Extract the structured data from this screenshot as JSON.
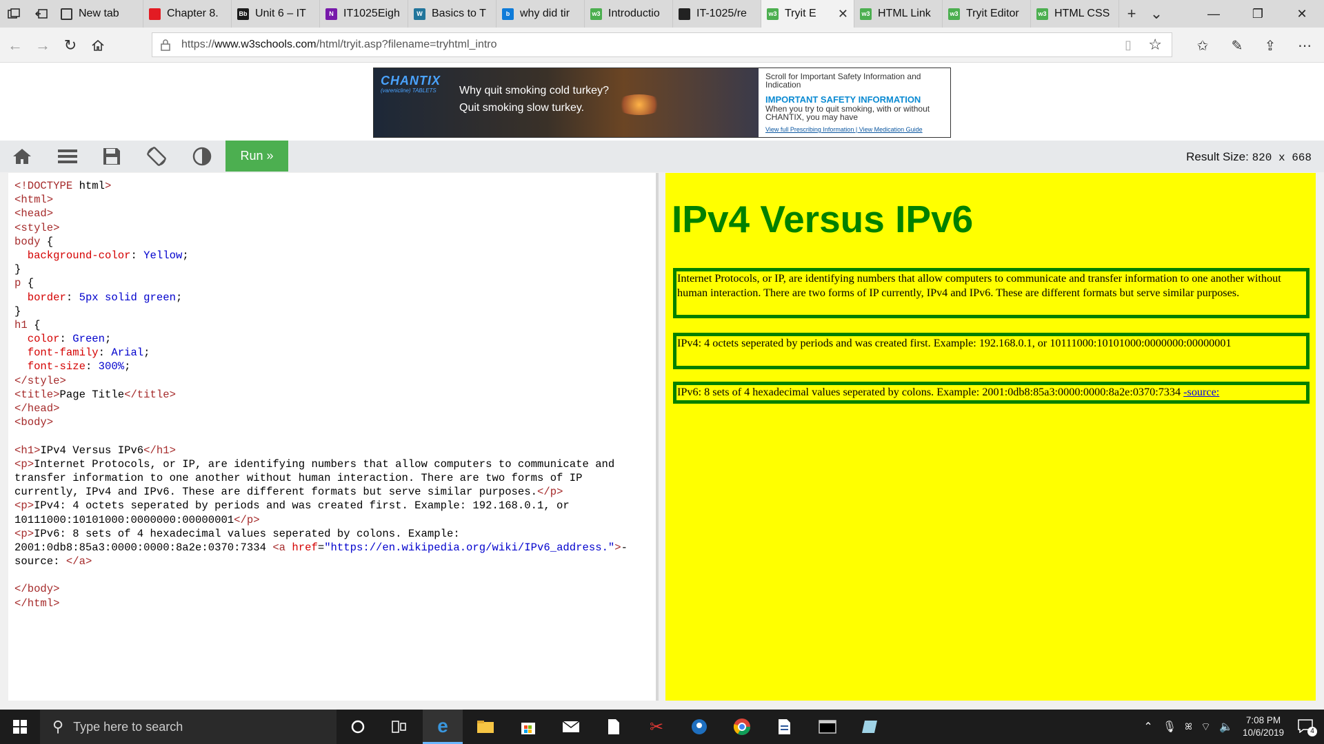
{
  "browser": {
    "tabs": [
      {
        "label": "New tab",
        "icon": "newtab-icon"
      },
      {
        "label": "Chapter 8.",
        "icon": "page-icon"
      },
      {
        "label": "Unit 6 – IT",
        "icon": "bb-icon",
        "badge": "Bb"
      },
      {
        "label": "IT1025Eigh",
        "icon": "onenote-icon",
        "badge": "N"
      },
      {
        "label": "Basics to T",
        "icon": "wordpress-icon",
        "badge": "W"
      },
      {
        "label": "why did tir",
        "icon": "bing-icon",
        "badge": "b"
      },
      {
        "label": "Introductio",
        "icon": "w3schools-icon",
        "badge": "w3"
      },
      {
        "label": "IT-1025/re",
        "icon": "github-icon"
      },
      {
        "label": "Tryit E",
        "icon": "w3schools-icon",
        "badge": "w3",
        "active": true
      },
      {
        "label": "HTML Link",
        "icon": "w3schools-icon",
        "badge": "w3"
      },
      {
        "label": "Tryit Editor",
        "icon": "w3schools-icon",
        "badge": "w3"
      },
      {
        "label": "HTML CSS",
        "icon": "w3schools-icon",
        "badge": "w3"
      }
    ],
    "url_prefix": "https://",
    "url_domain": "www.w3schools.com",
    "url_path": "/html/tryit.asp?filename=tryhtml_intro"
  },
  "ad": {
    "brand": "CHANTIX",
    "brand_sub": "(varenicline) TABLETS",
    "line1": "Why quit smoking cold turkey?",
    "line2": "Quit smoking slow turkey.",
    "safety_scroll": "Scroll for Important Safety Information and Indication",
    "safety_title": "IMPORTANT SAFETY INFORMATION",
    "safety_text": "When you try to quit smoking, with or without CHANTIX, you may have",
    "links": "View full Prescribing Information | View Medication Guide"
  },
  "toolbar": {
    "run_label": "Run »",
    "result_size_label": "Result Size:",
    "result_size_value": "820 x 668"
  },
  "code": {
    "lines": [
      "<!DOCTYPE html>",
      "<html>",
      "<head>",
      "<style>",
      "body {",
      "  background-color: Yellow;",
      "}",
      "p {",
      "  border: 5px solid green;",
      "}",
      "h1 {",
      "  color: Green;",
      "  font-family: Arial;",
      "  font-size: 300%;",
      "</style>",
      "<title>Page Title</title>",
      "</head>",
      "<body>",
      "",
      "<h1>IPv4 Versus IPv6</h1>",
      "<p>Internet Protocols, or IP, are identifying numbers that allow computers to communicate and",
      "transfer information to one another without human interaction. There are two forms of IP",
      "currently, IPv4 and IPv6. These are different formats but serve similar purposes.</p>",
      "<p>IPv4: 4 octets seperated by periods and was created first. Example: 192.168.0.1, or",
      "10111000:10101000:0000000:00000001</p>",
      "<p>IPv6: 8 sets of 4 hexadecimal values seperated by colons. Example:",
      "2001:0db8:85a3:0000:0000:8a2e:0370:7334 <a href=\"https://en.wikipedia.org/wiki/IPv6_address.\">-",
      "source: </a>",
      "",
      "</body>",
      "</html>"
    ]
  },
  "result": {
    "heading": "IPv4 Versus IPv6",
    "p1": "Internet Protocols, or IP, are identifying numbers that allow computers to communicate and transfer information to one another without human interaction. There are two forms of IP currently, IPv4 and IPv6. These are different formats but serve similar purposes.",
    "p2": "IPv4: 4 octets seperated by periods and was created first. Example: 192.168.0.1, or 10111000:10101000:0000000:00000001",
    "p3_text": "IPv6: 8 sets of 4 hexadecimal values seperated by colons. Example: 2001:0db8:85a3:0000:0000:8a2e:0370:7334 ",
    "p3_link": "-source:"
  },
  "taskbar": {
    "search_placeholder": "Type here to search",
    "time": "7:08 PM",
    "date": "10/6/2019",
    "notifications": "4"
  },
  "colors": {
    "run_green": "#4caf50",
    "result_bg": "#ffff00",
    "heading_green": "#008000"
  }
}
